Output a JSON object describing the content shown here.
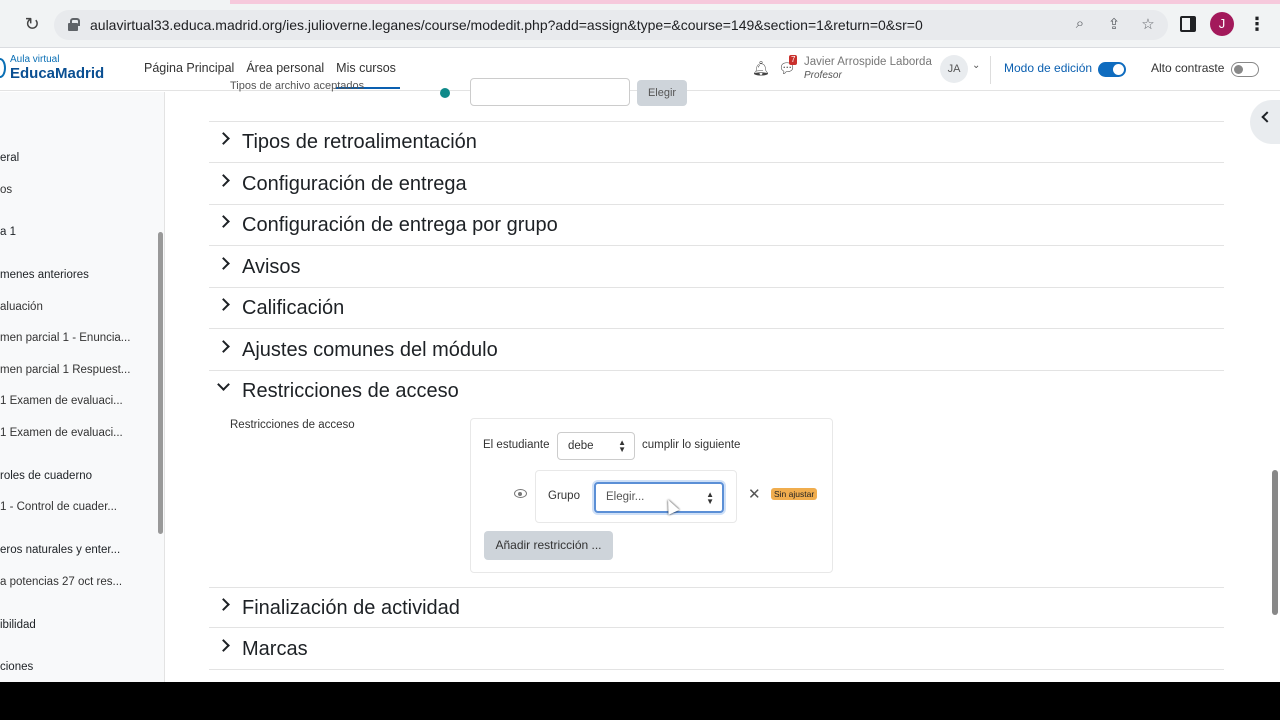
{
  "browser": {
    "url": "aulavirtual33.educa.madrid.org/ies.julioverne.leganes/course/modedit.php?add=assign&type=&course=149&section=1&return=0&sr=0",
    "profile_initial": "J"
  },
  "navbar": {
    "logo_small": "Aula virtual",
    "logo_big": "EducaMadrid",
    "links": [
      "Página Principal",
      "Área personal",
      "Mis cursos"
    ],
    "messages_count": "7",
    "user_name": "Javier Arrospide Laborda",
    "user_role": "Profesor",
    "avatar_initials": "JA",
    "edit_mode_label": "Modo de edición",
    "edit_mode_on": true,
    "contrast_label": "Alto contraste",
    "contrast_on": false
  },
  "drawer": {
    "items": [
      "eral",
      "os",
      "a 1",
      "menes anteriores",
      "aluación",
      "men parcial 1 - Enuncia...",
      "men parcial 1 Respuest...",
      "1 Examen de evaluaci...",
      "1 Examen de evaluaci...",
      "roles de cuaderno",
      "1 - Control de cuader...",
      "eros naturales y enter...",
      "a potencias 27 oct res...",
      "ibilidad",
      "ciones"
    ]
  },
  "main": {
    "top_partial_label": "Tipos de archivo aceptados",
    "top_button": "Elegir",
    "sections": [
      "Tipos de retroalimentación",
      "Configuración de entrega",
      "Configuración de entrega por grupo",
      "Avisos",
      "Calificación",
      "Ajustes comunes del módulo",
      "Restricciones de acceso",
      "Finalización de actividad",
      "Marcas"
    ],
    "restrictions": {
      "label": "Restricciones de acceso",
      "student_label": "El estudiante",
      "must_value": "debe",
      "follow_label": "cumplir lo siguiente",
      "group_label": "Grupo",
      "group_value": "Elegir...",
      "status_badge": "Sin ajustar",
      "add_button": "Añadir restricción ..."
    }
  }
}
